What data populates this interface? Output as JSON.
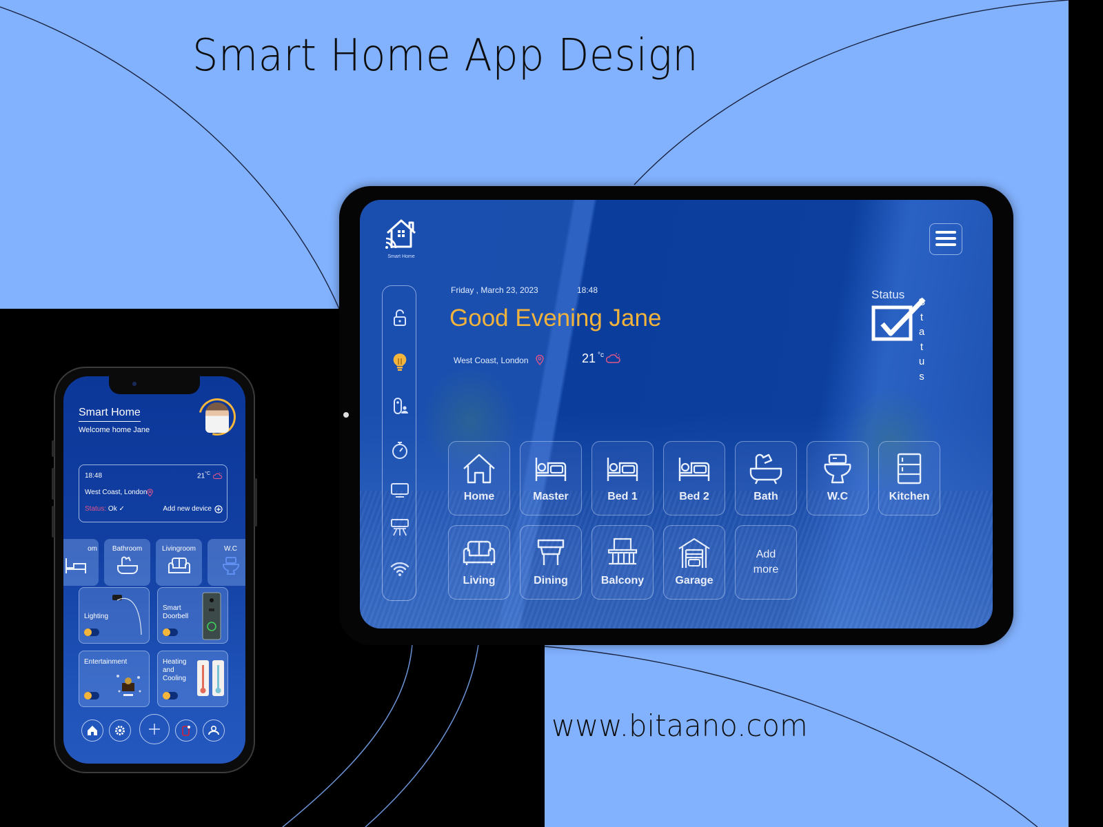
{
  "poster": {
    "headline": "Smart Home App Design",
    "website": "www.bitaano.com",
    "colors": {
      "background_light_blue": "#82b1fd",
      "background_black": "#000000",
      "app_blue": "#1a4fb0",
      "accent_yellow": "#f2b33d",
      "alert_pink": "#e0568a"
    }
  },
  "tablet": {
    "logo_icon": "smart-home-logo-icon",
    "logo_label": "Smart Home",
    "side_nav": [
      {
        "name": "lock",
        "icon": "unlock-icon",
        "active": false
      },
      {
        "name": "lighting",
        "icon": "lightbulb-icon",
        "active": true
      },
      {
        "name": "doorbell",
        "icon": "doorbell-user-icon",
        "active": false
      },
      {
        "name": "timer",
        "icon": "stopwatch-icon",
        "active": false
      },
      {
        "name": "tv",
        "icon": "monitor-icon",
        "active": false
      },
      {
        "name": "air-conditioner",
        "icon": "air-conditioner-icon",
        "active": false
      },
      {
        "name": "wifi",
        "icon": "wifi-icon",
        "active": false
      }
    ],
    "date": "Friday , March 23, 2023",
    "time": "18:48",
    "greeting": "Good Evening Jane",
    "location": "West Coast, London",
    "temperature": "21",
    "temperature_unit": "°c",
    "weather_icon": "cloud-sun-icon",
    "status_label": "Status",
    "status_vertical": "S\nt\na\nt\nu\ns",
    "menu_icon": "hamburger-menu-icon",
    "rooms": [
      {
        "label": "Home",
        "icon": "home-icon"
      },
      {
        "label": "Master",
        "icon": "bed-icon"
      },
      {
        "label": "Bed 1",
        "icon": "bed-icon"
      },
      {
        "label": "Bed 2",
        "icon": "bed-icon"
      },
      {
        "label": "Bath",
        "icon": "bathtub-icon"
      },
      {
        "label": "W.C",
        "icon": "toilet-icon"
      },
      {
        "label": "Kitchen",
        "icon": "fridge-icon"
      },
      {
        "label": "Living",
        "icon": "sofa-icon"
      },
      {
        "label": "Dining",
        "icon": "dining-table-icon"
      },
      {
        "label": "Balcony",
        "icon": "balcony-icon"
      },
      {
        "label": "Garage",
        "icon": "garage-icon"
      },
      {
        "label": "Add\nmore",
        "icon": ""
      }
    ]
  },
  "phone": {
    "title": "Smart Home",
    "subtitle": "Welcome home Jane",
    "info": {
      "time": "18:48",
      "temperature": "21",
      "temperature_unit": "°C",
      "location": "West Coast, London",
      "status_label": "Status:",
      "status_value": "Ok",
      "add_device_label": "Add new device"
    },
    "rooms": [
      {
        "label": "Bedroom",
        "visible_label": "om",
        "icon": "bed-icon"
      },
      {
        "label": "Bathroom",
        "icon": "bathtub-icon"
      },
      {
        "label": "Livingroom",
        "icon": "sofa-icon"
      },
      {
        "label": "W.C",
        "icon": "toilet-icon"
      }
    ],
    "devices": [
      {
        "label": "Lighting",
        "on": false
      },
      {
        "label": "Smart\nDoorbell",
        "on": false
      },
      {
        "label": "Entertainment",
        "on": false
      },
      {
        "label": "Heating\nand\nCooling",
        "on": false
      }
    ],
    "bottom_nav": [
      {
        "name": "home",
        "icon": "home-icon"
      },
      {
        "name": "settings",
        "icon": "gear-icon"
      },
      {
        "name": "add",
        "icon": "plus-icon"
      },
      {
        "name": "alerts",
        "icon": "phone-alert-icon"
      },
      {
        "name": "profile",
        "icon": "user-icon"
      }
    ]
  }
}
